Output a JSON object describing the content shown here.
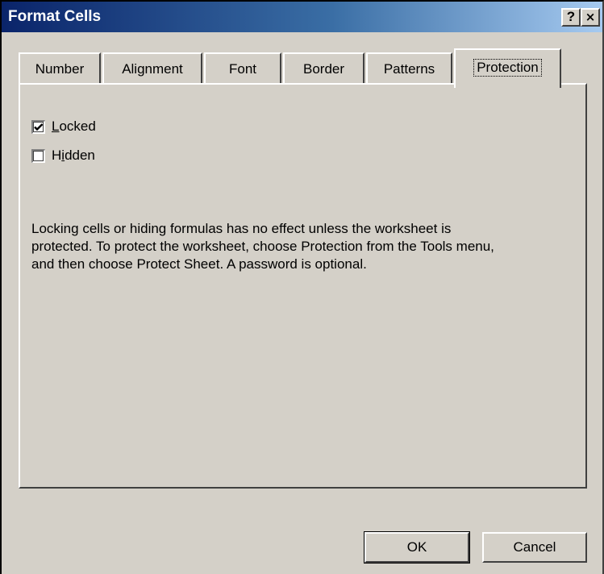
{
  "window": {
    "title": "Format Cells",
    "help_label": "?",
    "close_label": "×"
  },
  "tabs": [
    {
      "label": "Number",
      "active": false
    },
    {
      "label": "Alignment",
      "active": false
    },
    {
      "label": "Font",
      "active": false
    },
    {
      "label": "Border",
      "active": false
    },
    {
      "label": "Patterns",
      "active": false
    },
    {
      "label": "Protection",
      "active": true
    }
  ],
  "protection": {
    "locked": {
      "label_accel": "L",
      "label_rest": "ocked",
      "checked": true
    },
    "hidden": {
      "label_pre": "H",
      "label_accel": "i",
      "label_rest": "dden",
      "checked": false
    },
    "description": "Locking cells or hiding formulas has no effect unless the worksheet is protected. To protect the worksheet, choose Protection from the Tools menu, and then choose Protect Sheet. A password is optional."
  },
  "buttons": {
    "ok_label": "OK",
    "cancel_label": "Cancel"
  }
}
